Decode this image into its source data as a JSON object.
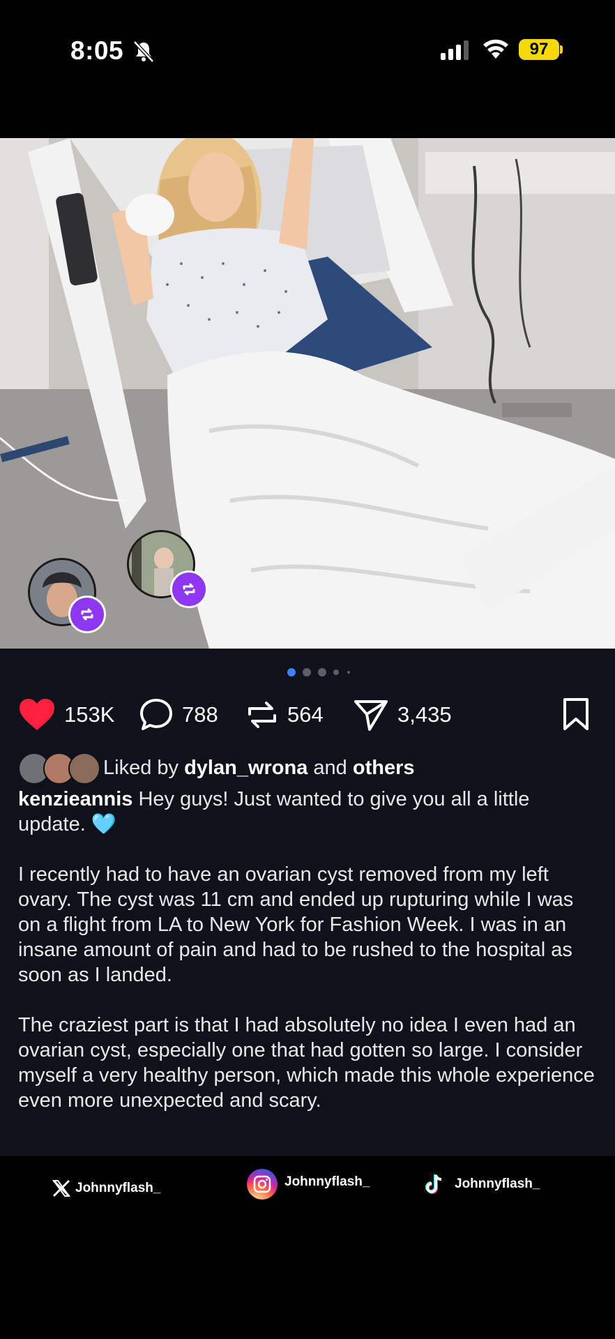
{
  "status_bar": {
    "time": "8:05",
    "battery": "97",
    "icons": [
      "bell-muted-icon",
      "signal-icon",
      "wifi-icon",
      "battery-icon"
    ]
  },
  "carousel": {
    "total_dots": 5,
    "active_index": 0
  },
  "actions": {
    "likes": "153K",
    "comments": "788",
    "reposts": "564",
    "shares": "3,435",
    "accent_like_color": "#ff2040"
  },
  "liked_by": {
    "prefix": "Liked by ",
    "user": "dylan_wrona",
    "connector": " and ",
    "others": "others"
  },
  "caption": {
    "username": "kenzieannis",
    "intro": " Hey guys! Just wanted to give you all a little update. ",
    "emoji": "🩵",
    "paragraph_2": "I recently had to have an ovarian cyst removed from my left ovary. The cyst was 11 cm and ended up rupturing while I was on a flight from LA to New York for Fashion Week. I was in an insane amount of pain and had to be rushed to the hospital as soon as I landed.",
    "paragraph_3": "The craziest part is that I had absolutely no idea I even had an ovarian cyst, especially one that had gotten so large. I consider myself a very healthy person, which made this whole experience even more unexpected and scary."
  },
  "credits": {
    "x_handle": "Johnnyflash_",
    "instagram_handle": "Johnnyflash_",
    "tiktok_handle": "Johnnyflash_"
  }
}
